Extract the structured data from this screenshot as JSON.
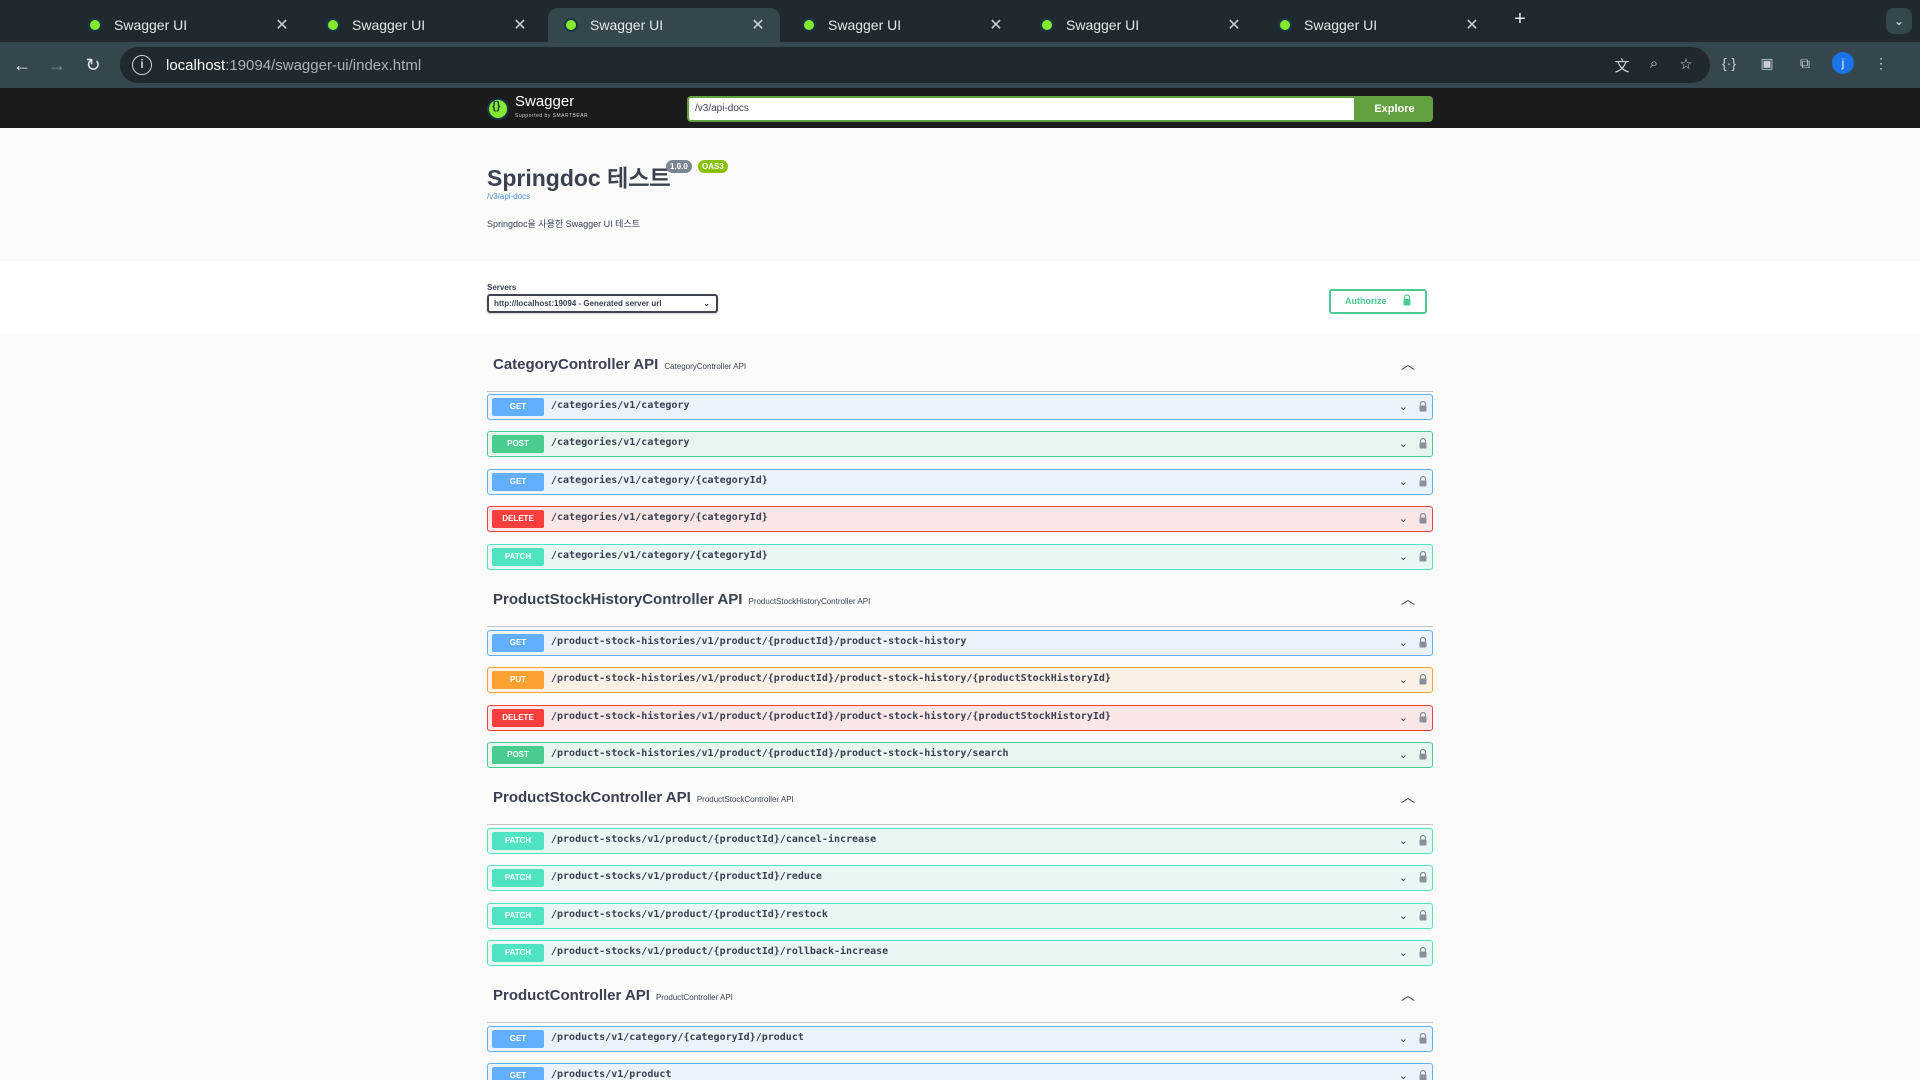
{
  "browser": {
    "tabs": [
      {
        "title": "Swagger UI",
        "active": false
      },
      {
        "title": "Swagger UI",
        "active": false
      },
      {
        "title": "Swagger UI",
        "active": true
      },
      {
        "title": "Swagger UI",
        "active": false
      },
      {
        "title": "Swagger UI",
        "active": false
      },
      {
        "title": "Swagger UI",
        "active": false
      }
    ],
    "url_host": "localhost",
    "url_rest": ":19094/swagger-ui/index.html",
    "avatar_letter": "j"
  },
  "topbar": {
    "logo_text": "Swagger",
    "logo_sub": "Supported by SMARTBEAR",
    "url_value": "/v3/api-docs",
    "explore_label": "Explore"
  },
  "info": {
    "title": "Springdoc 테스트",
    "version": "1.0.0",
    "oas": "OAS3",
    "link": "/v3/api-docs",
    "description": "Springdoc을 사용한 Swagger UI 테스트"
  },
  "scheme": {
    "servers_label": "Servers",
    "server_selected": "http://localhost:19094 - Generated server url",
    "authorize_label": "Authorize"
  },
  "colors": {
    "get": "#61affe",
    "post": "#49cc90",
    "delete": "#f93e3e",
    "patch": "#50e3c2",
    "put": "#fca130",
    "explore": "#62a03f"
  },
  "tags": [
    {
      "name": "CategoryController API",
      "description": "CategoryController API",
      "operations": [
        {
          "method": "GET",
          "path": "/categories/v1/category"
        },
        {
          "method": "POST",
          "path": "/categories/v1/category"
        },
        {
          "method": "GET",
          "path": "/categories/v1/category/{categoryId}"
        },
        {
          "method": "DELETE",
          "path": "/categories/v1/category/{categoryId}"
        },
        {
          "method": "PATCH",
          "path": "/categories/v1/category/{categoryId}"
        }
      ]
    },
    {
      "name": "ProductStockHistoryController API",
      "description": "ProductStockHistoryController API",
      "operations": [
        {
          "method": "GET",
          "path": "/product-stock-histories/v1/product/{productId}/product-stock-history"
        },
        {
          "method": "PUT",
          "path": "/product-stock-histories/v1/product/{productId}/product-stock-history/{productStockHistoryId}"
        },
        {
          "method": "DELETE",
          "path": "/product-stock-histories/v1/product/{productId}/product-stock-history/{productStockHistoryId}"
        },
        {
          "method": "POST",
          "path": "/product-stock-histories/v1/product/{productId}/product-stock-history/search"
        }
      ]
    },
    {
      "name": "ProductStockController API",
      "description": "ProductStockController API",
      "operations": [
        {
          "method": "PATCH",
          "path": "/product-stocks/v1/product/{productId}/cancel-increase"
        },
        {
          "method": "PATCH",
          "path": "/product-stocks/v1/product/{productId}/reduce"
        },
        {
          "method": "PATCH",
          "path": "/product-stocks/v1/product/{productId}/restock"
        },
        {
          "method": "PATCH",
          "path": "/product-stocks/v1/product/{productId}/rollback-increase"
        }
      ]
    },
    {
      "name": "ProductController API",
      "description": "ProductController API",
      "operations": [
        {
          "method": "GET",
          "path": "/products/v1/category/{categoryId}/product"
        },
        {
          "method": "GET",
          "path": "/products/v1/product"
        }
      ]
    }
  ]
}
